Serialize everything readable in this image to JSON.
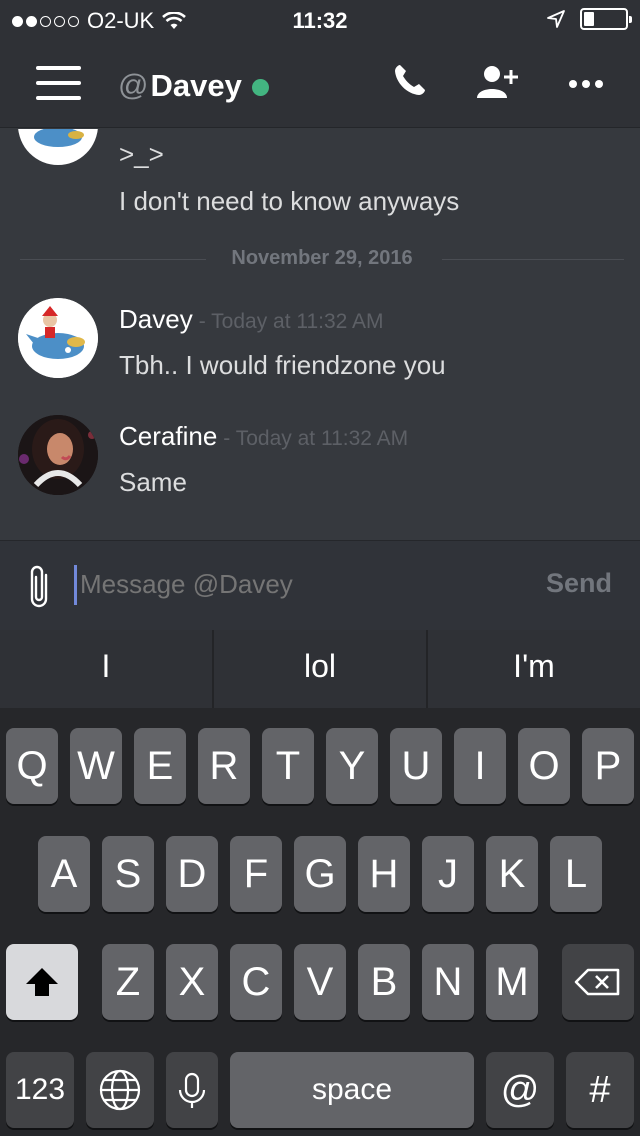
{
  "status_bar": {
    "signal_dots": 5,
    "signal_filled": 2,
    "carrier": "O2-UK",
    "time": "11:32",
    "battery_level": 0.22
  },
  "header": {
    "at_sign": "@",
    "channel_name": "Davey",
    "online": true
  },
  "messages": {
    "partial": [
      ">_>",
      "I don't need to know anyways"
    ],
    "date_divider": "November 29, 2016",
    "items": [
      {
        "author": "Davey",
        "timestamp": "- Today at 11:32 AM",
        "text": "Tbh.. I would friendzone you"
      },
      {
        "author": "Cerafine",
        "timestamp": "- Today at 11:32 AM",
        "text": "Same"
      }
    ]
  },
  "composer": {
    "placeholder": "Message @Davey",
    "send_label": "Send"
  },
  "keyboard": {
    "suggestions": [
      "I",
      "lol",
      "I'm"
    ],
    "row1": [
      "Q",
      "W",
      "E",
      "R",
      "T",
      "Y",
      "U",
      "I",
      "O",
      "P"
    ],
    "row2": [
      "A",
      "S",
      "D",
      "F",
      "G",
      "H",
      "J",
      "K",
      "L"
    ],
    "row3": [
      "Z",
      "X",
      "C",
      "V",
      "B",
      "N",
      "M"
    ],
    "numbers_label": "123",
    "space_label": "space",
    "at_label": "@",
    "hash_label": "#"
  },
  "colors": {
    "accent": "#7289da",
    "online": "#43b581",
    "background": "#36393e"
  }
}
